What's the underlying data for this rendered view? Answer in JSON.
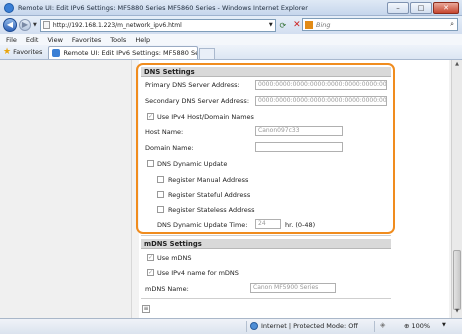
{
  "window": {
    "title": "Remote UI: Edit IPv6 Settings: MF5880 Series MF5860 Series - Windows Internet Explorer",
    "min_label": "–",
    "max_label": "□",
    "close_label": "✕"
  },
  "addressbar": {
    "url": "http://192.168.1.223/m_network_ipv6.html",
    "search_placeholder": "Bing",
    "refresh_glyph": "⟳",
    "stop_glyph": "✕",
    "search_glyph": "⌕"
  },
  "menu": [
    "File",
    "Edit",
    "View",
    "Favorites",
    "Tools",
    "Help"
  ],
  "favorites": {
    "label": "Favorites",
    "tab_title": "Remote UI: Edit IPv6 Settings: MF5880 Series MF5..."
  },
  "dns": {
    "header": "DNS Settings",
    "primary_label": "Primary DNS Server Address:",
    "primary_value": "0000:0000:0000:0000:0000:0000:0000:0000",
    "secondary_label": "Secondary DNS Server Address:",
    "secondary_value": "0000:0000:0000:0000:0000:0000:0000:0000",
    "use_ipv4_label": "Use IPv4 Host/Domain Names",
    "use_ipv4_checked": true,
    "host_label": "Host Name:",
    "host_value": "Canon097c33",
    "domain_label": "Domain Name:",
    "domain_value": "",
    "dynamic_label": "DNS Dynamic Update",
    "dynamic_checked": false,
    "reg_manual_label": "Register Manual Address",
    "reg_stateful_label": "Register Stateful Address",
    "reg_stateless_label": "Register Stateless Address",
    "interval_label": "DNS Dynamic Update Time:",
    "interval_value": "24",
    "interval_unit": "hr. (0-48)"
  },
  "mdns": {
    "header": "mDNS Settings",
    "use_label": "Use mDNS",
    "use_checked": true,
    "use_ipv4_label": "Use IPv4 name for mDNS",
    "use_ipv4_checked": true,
    "name_label": "mDNS Name:",
    "name_value": "Canon MF5900 Series"
  },
  "status": {
    "zone": "Internet | Protected Mode: Off",
    "zoom": "100%"
  }
}
